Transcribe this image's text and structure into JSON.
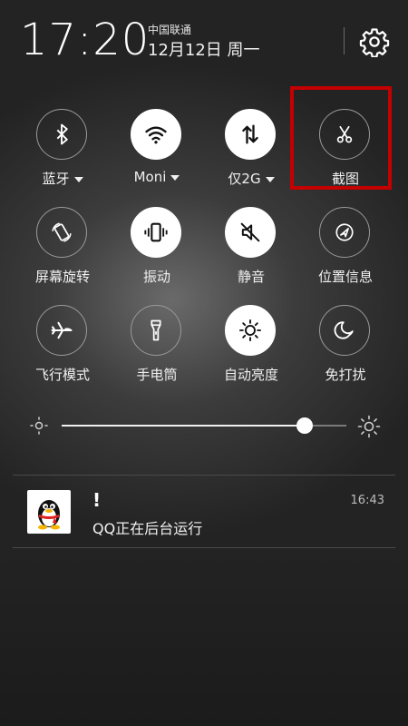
{
  "status": {
    "time": "17:20",
    "carrier": "中国联通",
    "date": "12月12日  周一"
  },
  "quick_settings": [
    {
      "label": "蓝牙",
      "icon": "bluetooth-icon",
      "active": false,
      "dropdown": true
    },
    {
      "label": "Moni",
      "icon": "wifi-icon",
      "active": true,
      "dropdown": true
    },
    {
      "label": "仅2G",
      "icon": "mobile-data-icon",
      "active": true,
      "dropdown": true
    },
    {
      "label": "截图",
      "icon": "scissors-icon",
      "active": false,
      "dropdown": false
    },
    {
      "label": "屏幕旋转",
      "icon": "screen-rotation-icon",
      "active": false,
      "dropdown": false
    },
    {
      "label": "振动",
      "icon": "vibrate-icon",
      "active": true,
      "dropdown": false
    },
    {
      "label": "静音",
      "icon": "mute-icon",
      "active": true,
      "dropdown": false
    },
    {
      "label": "位置信息",
      "icon": "location-icon",
      "active": false,
      "dropdown": false
    },
    {
      "label": "飞行模式",
      "icon": "airplane-icon",
      "active": false,
      "dropdown": false
    },
    {
      "label": "手电筒",
      "icon": "flashlight-icon",
      "active": false,
      "dropdown": false
    },
    {
      "label": "自动亮度",
      "icon": "auto-brightness-icon",
      "active": true,
      "dropdown": false
    },
    {
      "label": "免打扰",
      "icon": "moon-icon",
      "active": false,
      "dropdown": false
    }
  ],
  "brightness": {
    "level": 0.855
  },
  "notification": {
    "app_icon": "qq-penguin-icon",
    "title": "!",
    "text": "QQ正在后台运行",
    "time": "16:43"
  },
  "colors": {
    "highlight": "#c40000",
    "tile_active": "#ffffff"
  }
}
